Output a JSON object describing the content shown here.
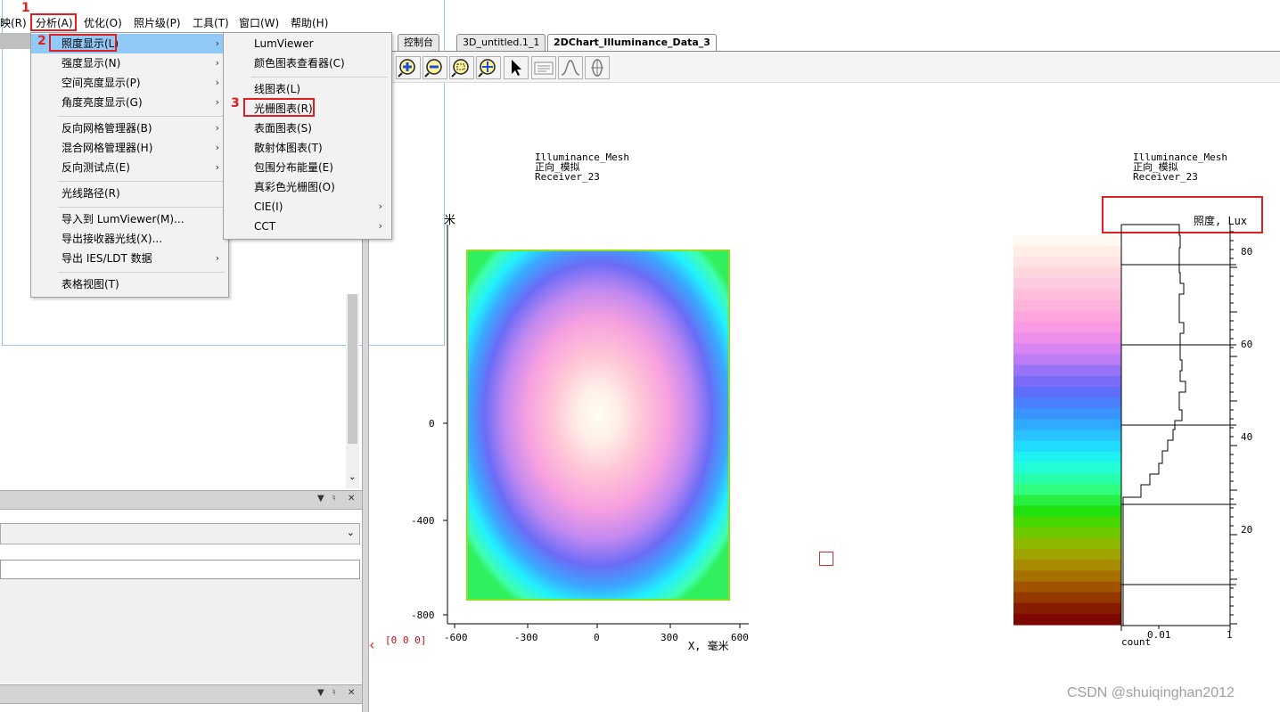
{
  "menubar": {
    "items": [
      "映(R)",
      "分析(A)",
      "优化(O)",
      "照片级(P)",
      "工具(T)",
      "窗口(W)",
      "帮助(H)"
    ]
  },
  "annotations": {
    "one": "1",
    "two": "2",
    "three": "3"
  },
  "analysis_menu": {
    "items": [
      {
        "label": "照度显示(L)",
        "submenu": true
      },
      {
        "label": "强度显示(N)",
        "submenu": true
      },
      {
        "label": "空间亮度显示(P)",
        "submenu": true
      },
      {
        "label": "角度亮度显示(G)",
        "submenu": true
      },
      {
        "label": "反向网格管理器(B)",
        "submenu": true
      },
      {
        "label": "混合网格管理器(H)",
        "submenu": true
      },
      {
        "label": "反向测试点(E)",
        "submenu": true
      },
      {
        "label": "光线路径(R)",
        "submenu": false
      },
      {
        "label": "导入到 LumViewer(M)...",
        "submenu": false
      },
      {
        "label": "导出接收器光线(X)...",
        "submenu": false
      },
      {
        "label": "导出 IES/LDT 数据",
        "submenu": true
      },
      {
        "label": "表格视图(T)",
        "submenu": false
      }
    ]
  },
  "illuminance_submenu": {
    "items": [
      {
        "label": "LumViewer",
        "submenu": false
      },
      {
        "label": "颜色图表查看器(C)",
        "submenu": false
      },
      {
        "label": "线图表(L)",
        "submenu": false
      },
      {
        "label": "光栅图表(R)",
        "submenu": false
      },
      {
        "label": "表面图表(S)",
        "submenu": false
      },
      {
        "label": "散射体图表(T)",
        "submenu": false
      },
      {
        "label": "包围分布能量(E)",
        "submenu": false
      },
      {
        "label": "真彩色光栅图(O)",
        "submenu": false
      },
      {
        "label": "CIE(I)",
        "submenu": true
      },
      {
        "label": "CCT",
        "submenu": true
      }
    ]
  },
  "tabs": [
    "控制台",
    "3D_untitled.1_1",
    "2DChart_Illuminance_Data_3"
  ],
  "toolbar": {
    "buttons": [
      "zoom-in-icon",
      "zoom-out-icon",
      "zoom-fit-icon",
      "pan-icon",
      "pointer-icon",
      "legend-icon",
      "distribution-icon",
      "crosshair-icon"
    ]
  },
  "chart_header_left": [
    "Illuminance_Mesh",
    "正向_模拟",
    "Receiver_23"
  ],
  "chart_header_right": [
    "Illuminance_Mesh",
    "正向_模拟",
    "Receiver_23"
  ],
  "chart_data": [
    {
      "type": "heatmap",
      "ylabel": "米",
      "xlabel": "X, 毫米",
      "x_ticks": [
        "-600",
        "-300",
        "0",
        "300",
        "600"
      ],
      "y_ticks": [
        "0",
        "-400",
        "-800"
      ],
      "origin_label": "[0 0 0]"
    },
    {
      "type": "bar",
      "title": "照度, Lux",
      "y_ticks": [
        "80",
        "60",
        "40",
        "20"
      ],
      "x_ticks": [
        "0.01",
        "1"
      ],
      "xlabel": "count"
    }
  ],
  "watermark": "CSDN @shuiqinghan2012",
  "colors": {
    "highlight": "#91c9f7",
    "annotation": "#e02020"
  }
}
